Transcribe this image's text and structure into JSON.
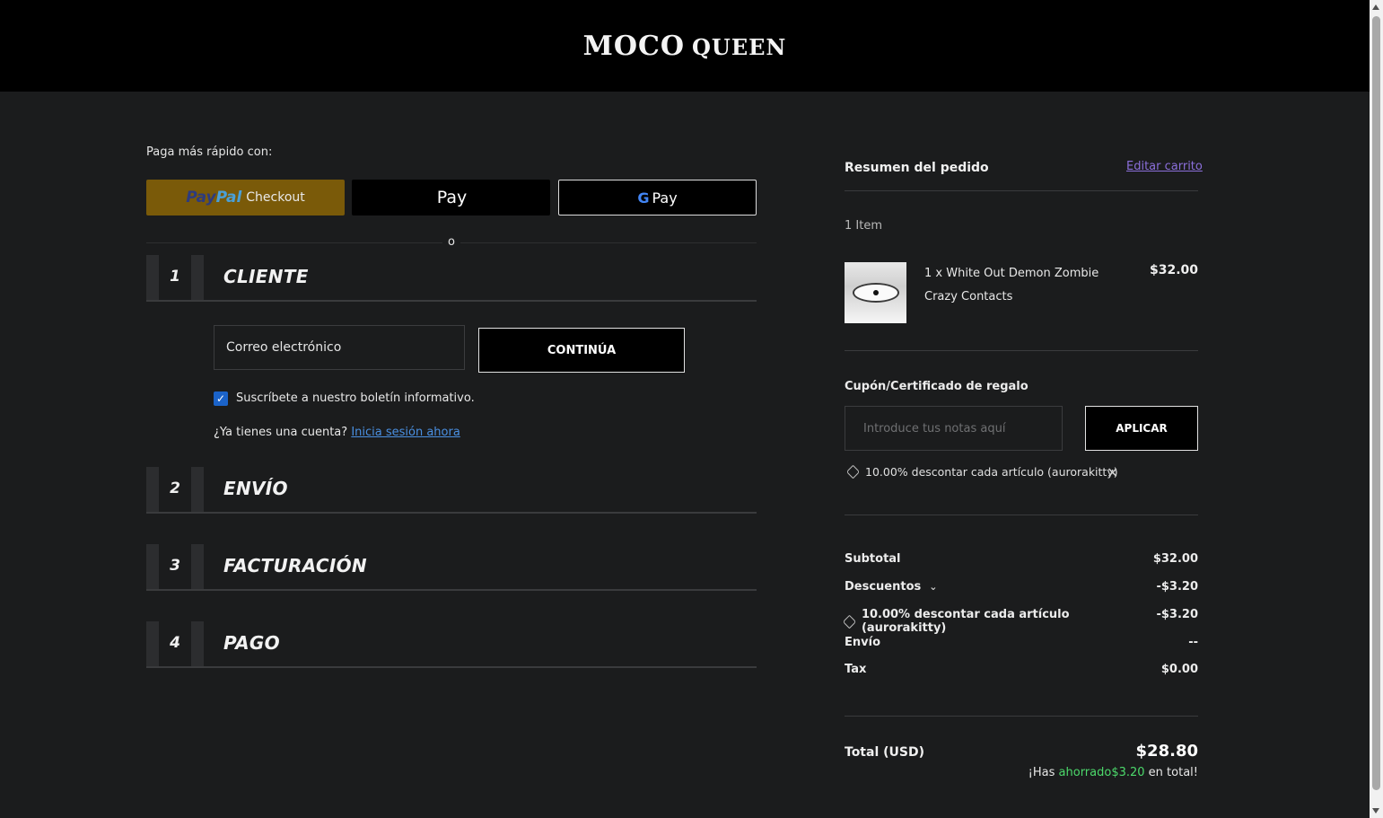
{
  "header": {
    "logo_part1": "MOCO",
    "logo_part2": "QUEEN"
  },
  "express": {
    "label": "Paga más rápido con:",
    "paypal_a": "Pay",
    "paypal_b": "Pal",
    "paypal_c": "Checkout",
    "apple_glyph": "",
    "apple_label": "Pay",
    "google_g": "G",
    "google_label": "Pay",
    "divider_text": "o"
  },
  "steps": [
    {
      "number": "1",
      "title": "CLIENTE"
    },
    {
      "number": "2",
      "title": "ENVÍO"
    },
    {
      "number": "3",
      "title": "FACTURACIÓN"
    },
    {
      "number": "4",
      "title": "PAGO"
    }
  ],
  "customer": {
    "email_placeholder": "Correo electrónico",
    "continue_label": "CONTINÚA",
    "newsletter_checked": true,
    "newsletter_label": "Suscríbete a nuestro boletín informativo.",
    "account_prompt": "¿Ya tienes una cuenta?",
    "signin_link": "Inicia sesión ahora"
  },
  "summary": {
    "title": "Resumen del pedido",
    "edit_cart": "Editar carrito",
    "item_count": "1 Item",
    "items": [
      {
        "name": "1 x White Out Demon Zombie Crazy Contacts",
        "price": "$32.00"
      }
    ],
    "coupon_label": "Cupón/Certificado de regalo",
    "coupon_placeholder": "Introduce tus notas aquí",
    "apply_label": "APLICAR",
    "applied_coupon": "10.00% descontar cada artículo (aurorakitty)",
    "subtotal_label": "Subtotal",
    "subtotal_value": "$32.00",
    "discounts_label": "Descuentos",
    "discounts_value": "-$3.20",
    "discount_detail_label": "10.00% descontar cada artículo (aurorakitty)",
    "discount_detail_value": "-$3.20",
    "shipping_label": "Envío",
    "shipping_value": "--",
    "tax_label": "Tax",
    "tax_value": "$0.00",
    "total_label": "Total (USD)",
    "total_value": "$28.80",
    "saved_prefix": "¡Has ",
    "saved_green": "ahorrado$3.20",
    "saved_suffix": " en total!"
  },
  "colors": {
    "background": "#1b1c1d",
    "header": "#000000",
    "paypal_button": "#7a5a09",
    "link_blue": "#4a90e2",
    "edit_purple": "#8b6fdb",
    "saved_green": "#4cd96b",
    "checkbox_blue": "#1b63c9"
  }
}
